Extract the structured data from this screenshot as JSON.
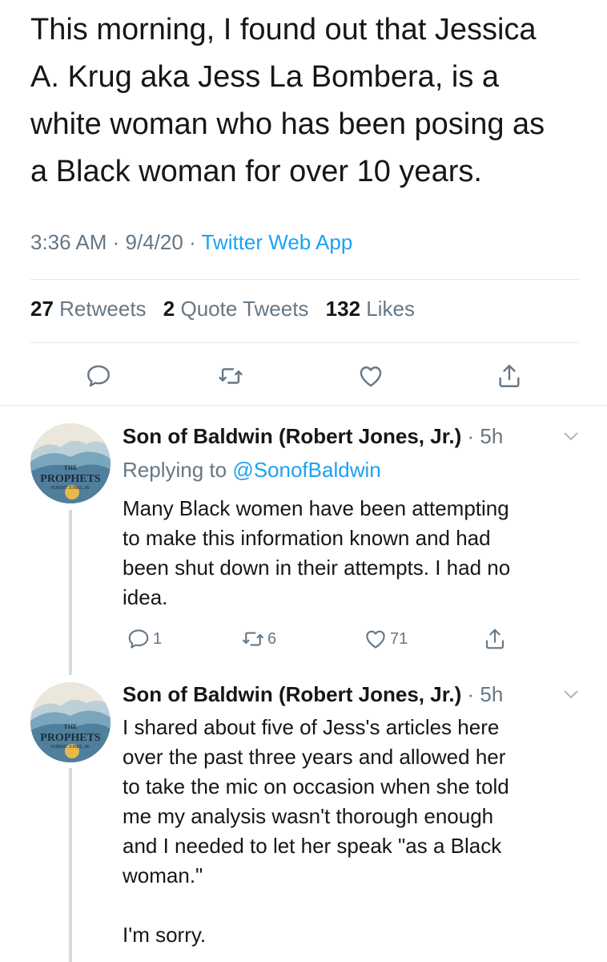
{
  "main_tweet": {
    "text": "This morning, I found out that Jessica\nA. Krug aka Jess La Bombera, is a\nwhite woman who has been posing as\na Black woman for over 10 years.",
    "time": "3:36 AM",
    "date": "9/4/20",
    "source": "Twitter Web App",
    "retweets_count": "27",
    "retweets_label": "Retweets",
    "quotes_count": "2",
    "quotes_label": "Quote Tweets",
    "likes_count": "132",
    "likes_label": "Likes",
    "actions": [
      "reply-icon",
      "retweet-icon",
      "like-icon",
      "share-icon"
    ]
  },
  "replies": [
    {
      "author": "Son of Baldwin (Robert Jones, Jr.)",
      "time": "5h",
      "replying_prefix": "Replying to",
      "replying_handle": "@SonofBaldwin",
      "text": "Many Black women have been attempting\nto make this information known and had\nbeen shut down in their attempts. I had no\nidea.",
      "reply_count": "1",
      "retweet_count": "6",
      "like_count": "71",
      "avatar": {
        "title": "THE",
        "main": "PROPHETS",
        "sub": "ROBERT JONES, JR."
      }
    },
    {
      "author": "Son of Baldwin (Robert Jones, Jr.)",
      "time": "5h",
      "text": "I shared about five of Jess's articles here\nover the past three years and allowed her\nto take the mic on occasion when she told\nme my analysis wasn't thorough enough\nand I needed to let her speak \"as a Black\nwoman.\"\n\nI'm sorry.",
      "avatar": {
        "title": "THE",
        "main": "PROPHETS",
        "sub": "ROBERT JONES, JR."
      }
    }
  ],
  "colors": {
    "text": "#14171a",
    "secondary": "#657786",
    "link": "#1da1f2",
    "divider": "#e1e8ed"
  }
}
